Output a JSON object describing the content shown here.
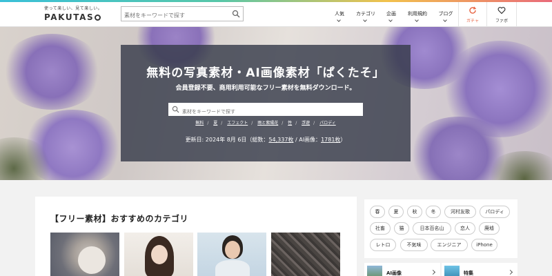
{
  "header": {
    "logo_tagline": "使って楽しい、見て楽しい。",
    "logo_word": "PAKUTAS",
    "search_placeholder": "素材をキーワードで探す",
    "nav": [
      {
        "label": "人気"
      },
      {
        "label": "カテゴリ"
      },
      {
        "label": "企画"
      },
      {
        "label": "利用規約"
      },
      {
        "label": "ブログ"
      }
    ],
    "gacha_label": "ガチャ",
    "favorites_label": "ファボ"
  },
  "hero": {
    "title": "無料の写真素材・AI画像素材「ぱくたそ」",
    "subtitle": "会員登録不要、商用利用可能なフリー素材を無料ダウンロード。",
    "search_placeholder": "素材をキーワードで探す",
    "tags": [
      "無料",
      "夏",
      "エフェクト",
      "雨と紫陽花",
      "性",
      "浮遊",
      "パロディ"
    ],
    "updated_prefix": "更新日: 2024年 8月 6日（総数：",
    "total_count": "54,337枚",
    "ai_prefix": " / AI画像：",
    "ai_count": "1781枚",
    "updated_suffix": "）"
  },
  "main": {
    "section_title": "【フリー素材】おすすめのカテゴリ"
  },
  "sidebar": {
    "chips": [
      "春",
      "夏",
      "秋",
      "冬",
      "河村友歌",
      "パロディ",
      "社畜",
      "猫",
      "日本百名山",
      "恋人",
      "廃墟",
      "レトロ",
      "不気味",
      "エンジニア",
      "iPhone"
    ],
    "links": [
      {
        "label": "AI画像"
      },
      {
        "label": "特集"
      }
    ]
  },
  "colors": {
    "accent": "#e96a4a",
    "panel": "#373c4b"
  }
}
